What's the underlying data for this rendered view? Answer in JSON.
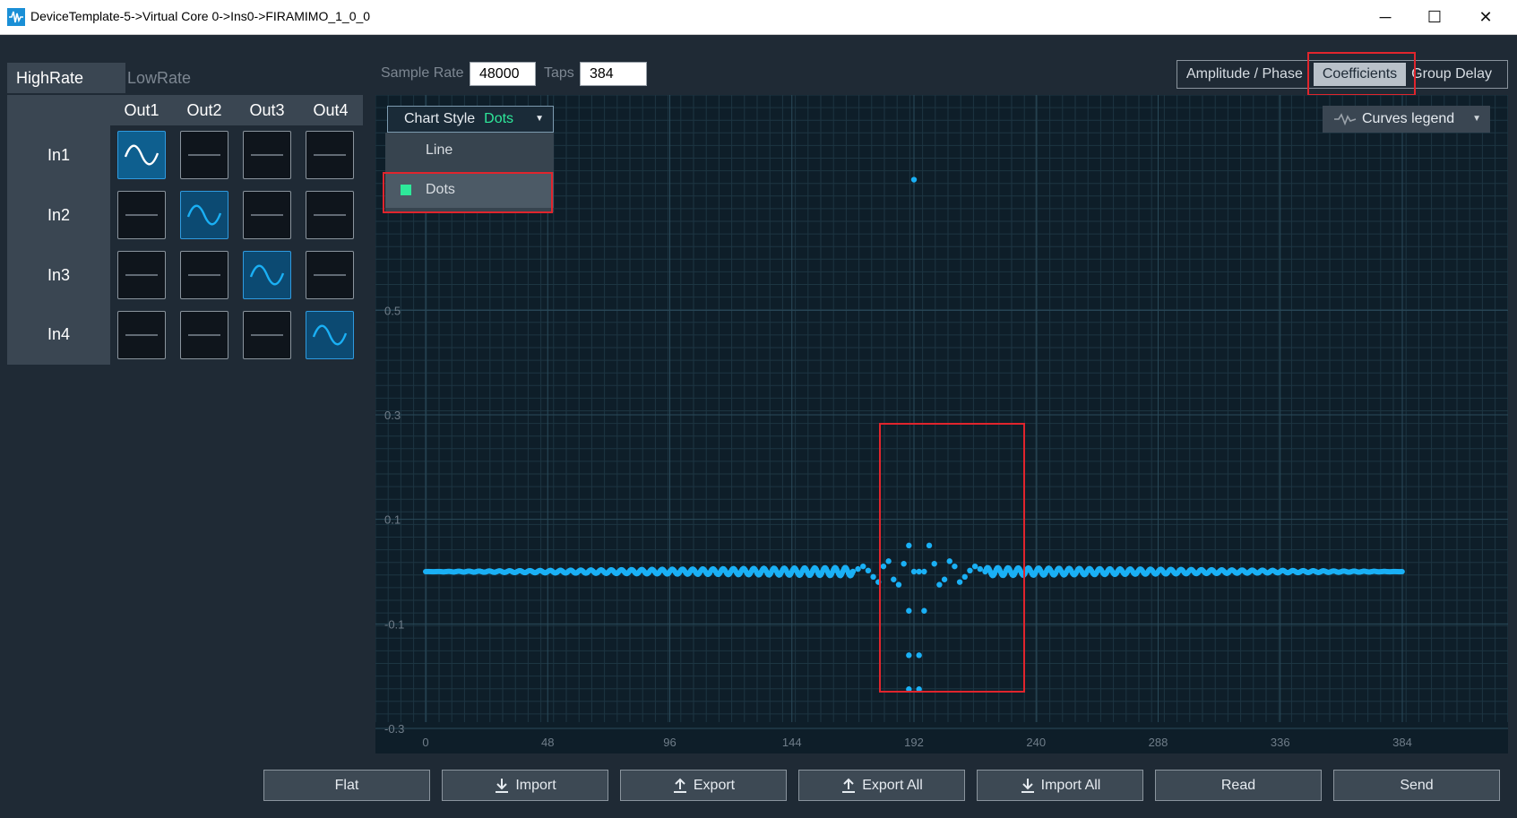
{
  "window": {
    "title": "DeviceTemplate-5->Virtual Core 0->Ins0->FIRAMIMO_1_0_0",
    "minimize_glyph": "─",
    "maximize_glyph": "☐",
    "close_glyph": "✕"
  },
  "rate_tabs": {
    "active": "HighRate",
    "inactive": "LowRate"
  },
  "matrix": {
    "columns": [
      "Out1",
      "Out2",
      "Out3",
      "Out4"
    ],
    "rows": [
      "In1",
      "In2",
      "In3",
      "In4"
    ],
    "active_cells": [
      [
        0,
        0
      ],
      [
        1,
        1
      ],
      [
        2,
        2
      ],
      [
        3,
        3
      ]
    ]
  },
  "controls": {
    "sample_rate_label": "Sample Rate",
    "sample_rate_value": "48000",
    "taps_label": "Taps",
    "taps_value": "384"
  },
  "view_tabs": {
    "amplitude_phase": "Amplitude / Phase",
    "coefficients": "Coefficients",
    "group_delay": "Group Delay",
    "selected": "Coefficients"
  },
  "chart_style": {
    "label": "Chart Style",
    "value": "Dots",
    "options": [
      "Line",
      "Dots"
    ],
    "selected_option": "Dots"
  },
  "legend_dropdown": {
    "label": "Curves legend"
  },
  "buttons": {
    "flat": "Flat",
    "import": "Import",
    "export": "Export",
    "export_all": "Export All",
    "import_all": "Import All",
    "read": "Read",
    "send": "Send"
  },
  "colors": {
    "accent": "#1ab0f5",
    "highlight": "#e0252d",
    "dots_green": "#2ee89a",
    "background": "#1f2a35",
    "chart_bg": "#0e1e29"
  },
  "chart_data": {
    "type": "scatter",
    "title": "",
    "xlabel": "",
    "ylabel": "",
    "x_ticks": [
      0,
      48,
      96,
      144,
      192,
      240,
      288,
      336,
      384
    ],
    "y_ticks": [
      0.5,
      0.3,
      0.1,
      -0.1,
      -0.3
    ],
    "xlim": [
      0,
      384
    ],
    "ylim": [
      -0.3,
      0.75
    ],
    "grid": true,
    "series": [
      {
        "points": [
          [
            192,
            0.75
          ],
          [
            168,
            0.0
          ],
          [
            170,
            0.005
          ],
          [
            172,
            0.01
          ],
          [
            174,
            0.002
          ],
          [
            176,
            -0.01
          ],
          [
            178,
            -0.02
          ],
          [
            180,
            0.01
          ],
          [
            182,
            0.02
          ],
          [
            184,
            -0.015
          ],
          [
            186,
            -0.025
          ],
          [
            188,
            0.015
          ],
          [
            190,
            0.05
          ],
          [
            192,
            0.0
          ],
          [
            194,
            0.0
          ],
          [
            190,
            -0.075
          ],
          [
            196,
            -0.075
          ],
          [
            190,
            -0.16
          ],
          [
            194,
            -0.16
          ],
          [
            190,
            -0.225
          ],
          [
            194,
            -0.225
          ],
          [
            196,
            0.0
          ],
          [
            198,
            0.05
          ],
          [
            200,
            0.015
          ],
          [
            202,
            -0.025
          ],
          [
            204,
            -0.015
          ],
          [
            206,
            0.02
          ],
          [
            208,
            0.01
          ],
          [
            210,
            -0.02
          ],
          [
            212,
            -0.01
          ],
          [
            214,
            0.002
          ],
          [
            216,
            0.01
          ],
          [
            218,
            0.005
          ],
          [
            220,
            0.0
          ]
        ],
        "ripple_amplitude_near_center": 0.008,
        "ripple_period_taps": 4
      }
    ]
  }
}
